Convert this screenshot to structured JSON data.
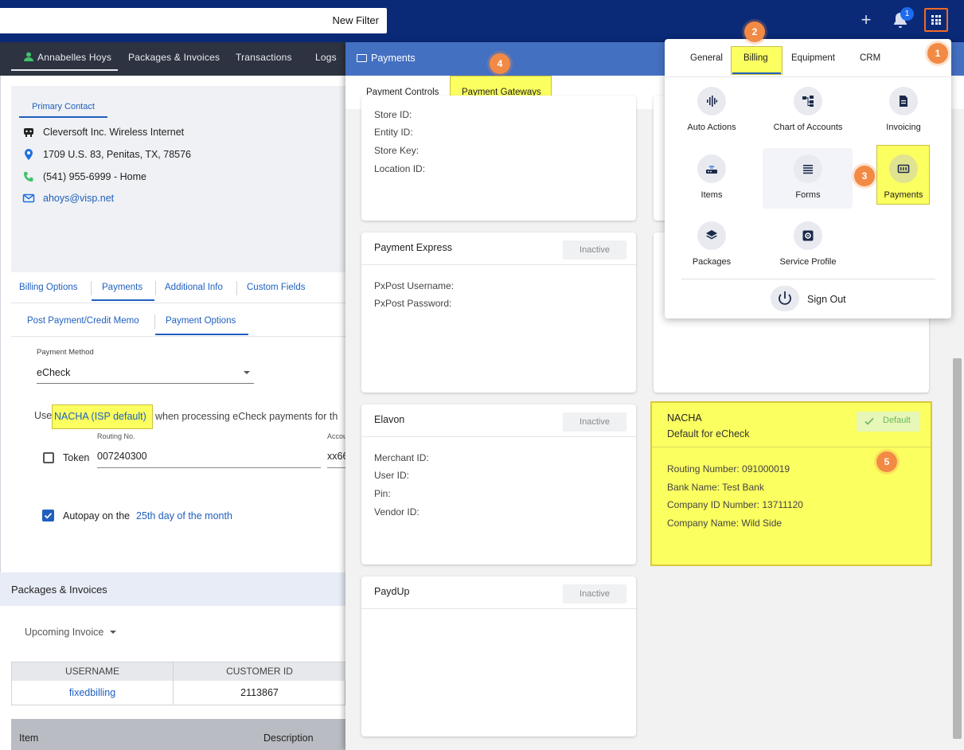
{
  "topbar": {
    "filter_label": "New Filter",
    "plus_icon": "+",
    "notifications_count": "1",
    "apps_icon": "apps-grid-icon"
  },
  "customer": {
    "tabs": [
      "Annabelles Hoys",
      "Packages & Invoices",
      "Transactions",
      "Logs"
    ],
    "primary_contact_tab": "Primary Contact",
    "company": "Cleversoft Inc. Wireless Internet",
    "address": "1709 U.S. 83, Penitas, TX, 78576",
    "phone": "(541) 955-6999 - Home",
    "email": "ahoys@visp.net",
    "billing_tabs": [
      "Billing Options",
      "Payments",
      "Additional Info",
      "Custom Fields"
    ],
    "payment_subtabs": [
      "Post Payment/Credit Memo",
      "Payment Options"
    ],
    "payment_method_label": "Payment Method",
    "payment_method_value": "eCheck",
    "use_prefix": "Use",
    "use_gateway": "NACHA (ISP default)",
    "use_suffix": "when processing eCheck payments for th",
    "routing_label": "Routing No.",
    "routing_value": "007240300",
    "account_label": "Accou",
    "account_value": "xx66",
    "token_label": "Token",
    "autopay_label": "Autopay on the",
    "autopay_link": "25th day of the month",
    "packages_title": "Packages & Invoices",
    "upcoming_label": "Upcoming Invoice",
    "table_headers": [
      "USERNAME",
      "CUSTOMER ID"
    ],
    "table_row": [
      "fixedbilling",
      "2113867"
    ],
    "items_headers": [
      "Item",
      "Description"
    ]
  },
  "payments": {
    "title": "Payments",
    "tabs": [
      "Payment Controls",
      "Payment Gateways"
    ],
    "inactive_label": "Inactive",
    "cards": {
      "top": {
        "fields": [
          "Store ID:",
          "Entity ID:",
          "Store Key:",
          "Location ID:"
        ]
      },
      "payment_express": {
        "title": "Payment Express",
        "fields": [
          "PxPost Username:",
          "PxPost Password:"
        ]
      },
      "elavon": {
        "title": "Elavon",
        "fields": [
          "Merchant ID:",
          "User ID:",
          "Pin:",
          "Vendor ID:"
        ]
      },
      "paydup": {
        "title": "PaydUp"
      },
      "nacha": {
        "title": "NACHA",
        "subtitle": "Default for eCheck",
        "default_label": "Default",
        "fields": [
          "Routing Number: 091000019",
          "Bank Name: Test Bank",
          "Company ID Number: 13711120",
          "Company Name: Wild Side"
        ]
      }
    }
  },
  "app_menu": {
    "tabs": [
      "General",
      "Billing",
      "Equipment",
      "CRM"
    ],
    "items": [
      "Auto Actions",
      "Chart of Accounts",
      "Invoicing",
      "Items",
      "Forms",
      "Payments",
      "Packages",
      "Service Profile"
    ],
    "sign_out": "Sign Out"
  },
  "steps": [
    "1",
    "2",
    "3",
    "4",
    "5"
  ],
  "colors": {
    "topbar": "#0a2a78",
    "panel_header": "#4470c2",
    "highlight": "#fbff60",
    "step_badge": "#f28a45",
    "link": "#1f5fbf"
  }
}
